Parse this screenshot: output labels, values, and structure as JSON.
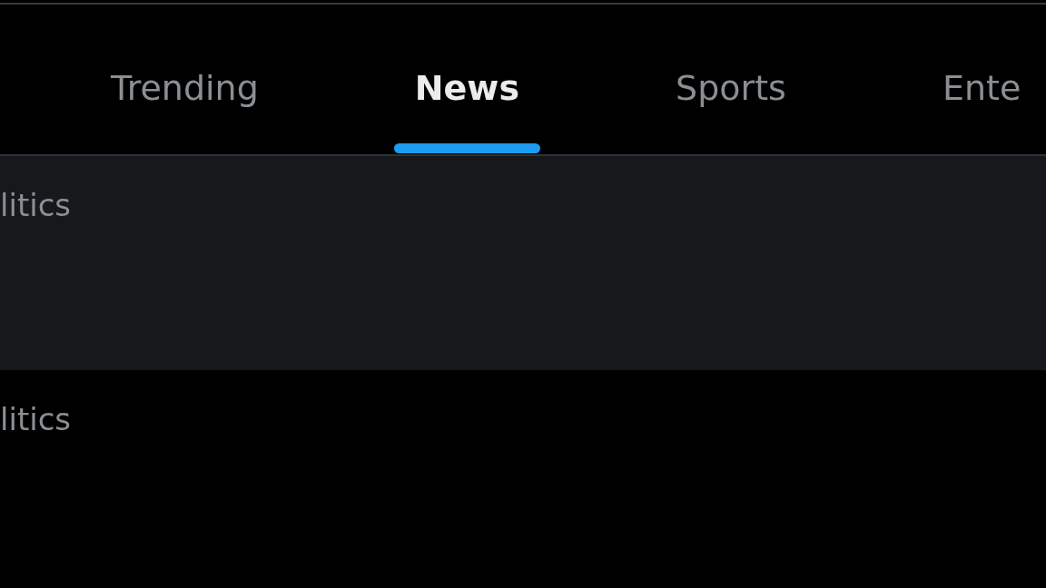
{
  "tabs": [
    {
      "label": "Trending",
      "selected": false
    },
    {
      "label": "News",
      "selected": true
    },
    {
      "label": "Sports",
      "selected": false
    },
    {
      "label": "Ente",
      "selected": false
    }
  ],
  "rows": [
    {
      "label": "litics",
      "highlighted": true
    },
    {
      "label": "litics",
      "highlighted": false
    }
  ]
}
